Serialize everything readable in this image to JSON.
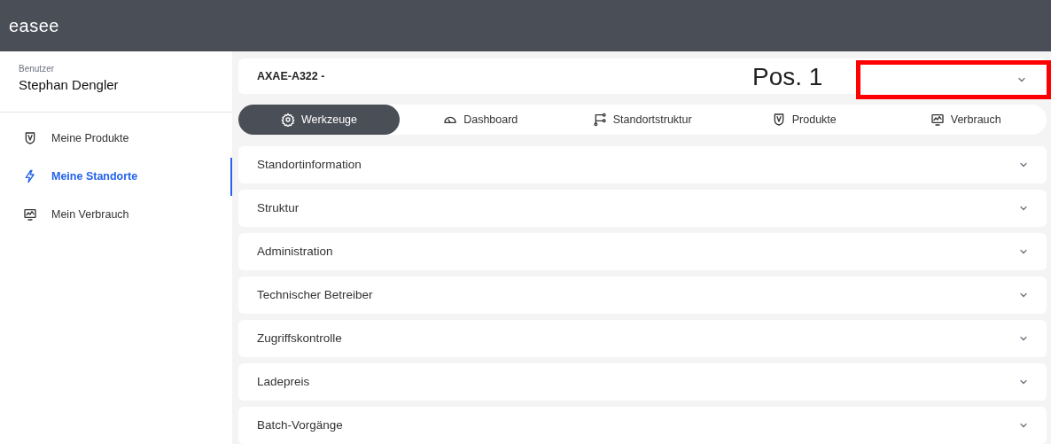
{
  "header": {
    "logo": "easee"
  },
  "user": {
    "label": "Benutzer",
    "name": "Stephan Dengler"
  },
  "sidebar": {
    "items": [
      {
        "label": "Meine Produkte",
        "selected": false
      },
      {
        "label": "Meine Standorte",
        "selected": true
      },
      {
        "label": "Mein Verbrauch",
        "selected": false
      }
    ]
  },
  "site": {
    "name": "AXAE-A322 -"
  },
  "annotation": {
    "label": "Pos. 1"
  },
  "tabs": [
    {
      "label": "Werkzeuge",
      "selected": true
    },
    {
      "label": "Dashboard",
      "selected": false
    },
    {
      "label": "Standortstruktur",
      "selected": false
    },
    {
      "label": "Produkte",
      "selected": false
    },
    {
      "label": "Verbrauch",
      "selected": false
    }
  ],
  "sections": [
    {
      "title": "Standortinformation",
      "expanded": false
    },
    {
      "title": "Struktur",
      "expanded": false
    },
    {
      "title": "Administration",
      "expanded": false
    },
    {
      "title": "Technischer Betreiber",
      "expanded": false
    },
    {
      "title": "Zugriffskontrolle",
      "expanded": false
    },
    {
      "title": "Ladepreis",
      "expanded": false
    },
    {
      "title": "Batch-Vorgänge",
      "expanded": false
    }
  ]
}
